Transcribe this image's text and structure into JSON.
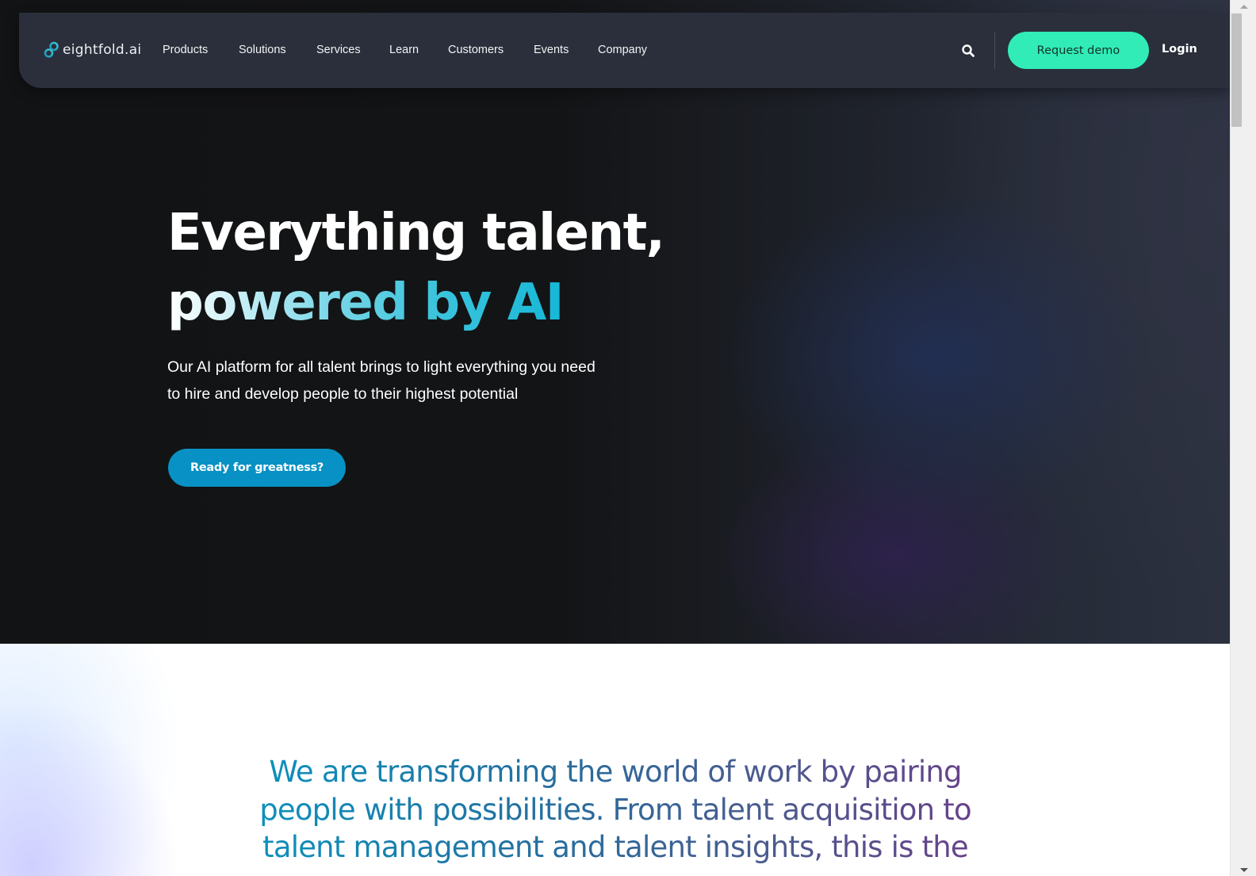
{
  "nav": {
    "logo_text": "eightfold.ai",
    "logo_icon": "infinity-link-icon",
    "items": [
      {
        "label": "Products"
      },
      {
        "label": "Solutions"
      },
      {
        "label": "Services"
      },
      {
        "label": "Learn"
      },
      {
        "label": "Customers"
      },
      {
        "label": "Events"
      },
      {
        "label": "Company"
      }
    ],
    "search_icon": "search-icon",
    "request_demo_label": "Request demo",
    "login_label": "Login"
  },
  "hero": {
    "headline_line1": "Everything talent,",
    "headline_line2": "powered by AI",
    "subheadline_line1": "Our AI platform for all talent brings to light everything you need",
    "subheadline_line2": "to hire and develop people to their highest potential",
    "cta_label": "Ready for greatness?"
  },
  "mission": {
    "line1": "We are transforming the world of work by pairing",
    "line2": "people with possibilities. From talent acquisition to",
    "line3": "talent management and talent insights, this is the"
  },
  "colors": {
    "nav_background": "#2a2f3b",
    "request_demo_bg": "#31ecb6",
    "cta_bg": "#0891c4",
    "headline_accent": "#16b8d6",
    "mission_gradient_start": "#0b93be",
    "mission_gradient_end": "#6a3f8a"
  }
}
